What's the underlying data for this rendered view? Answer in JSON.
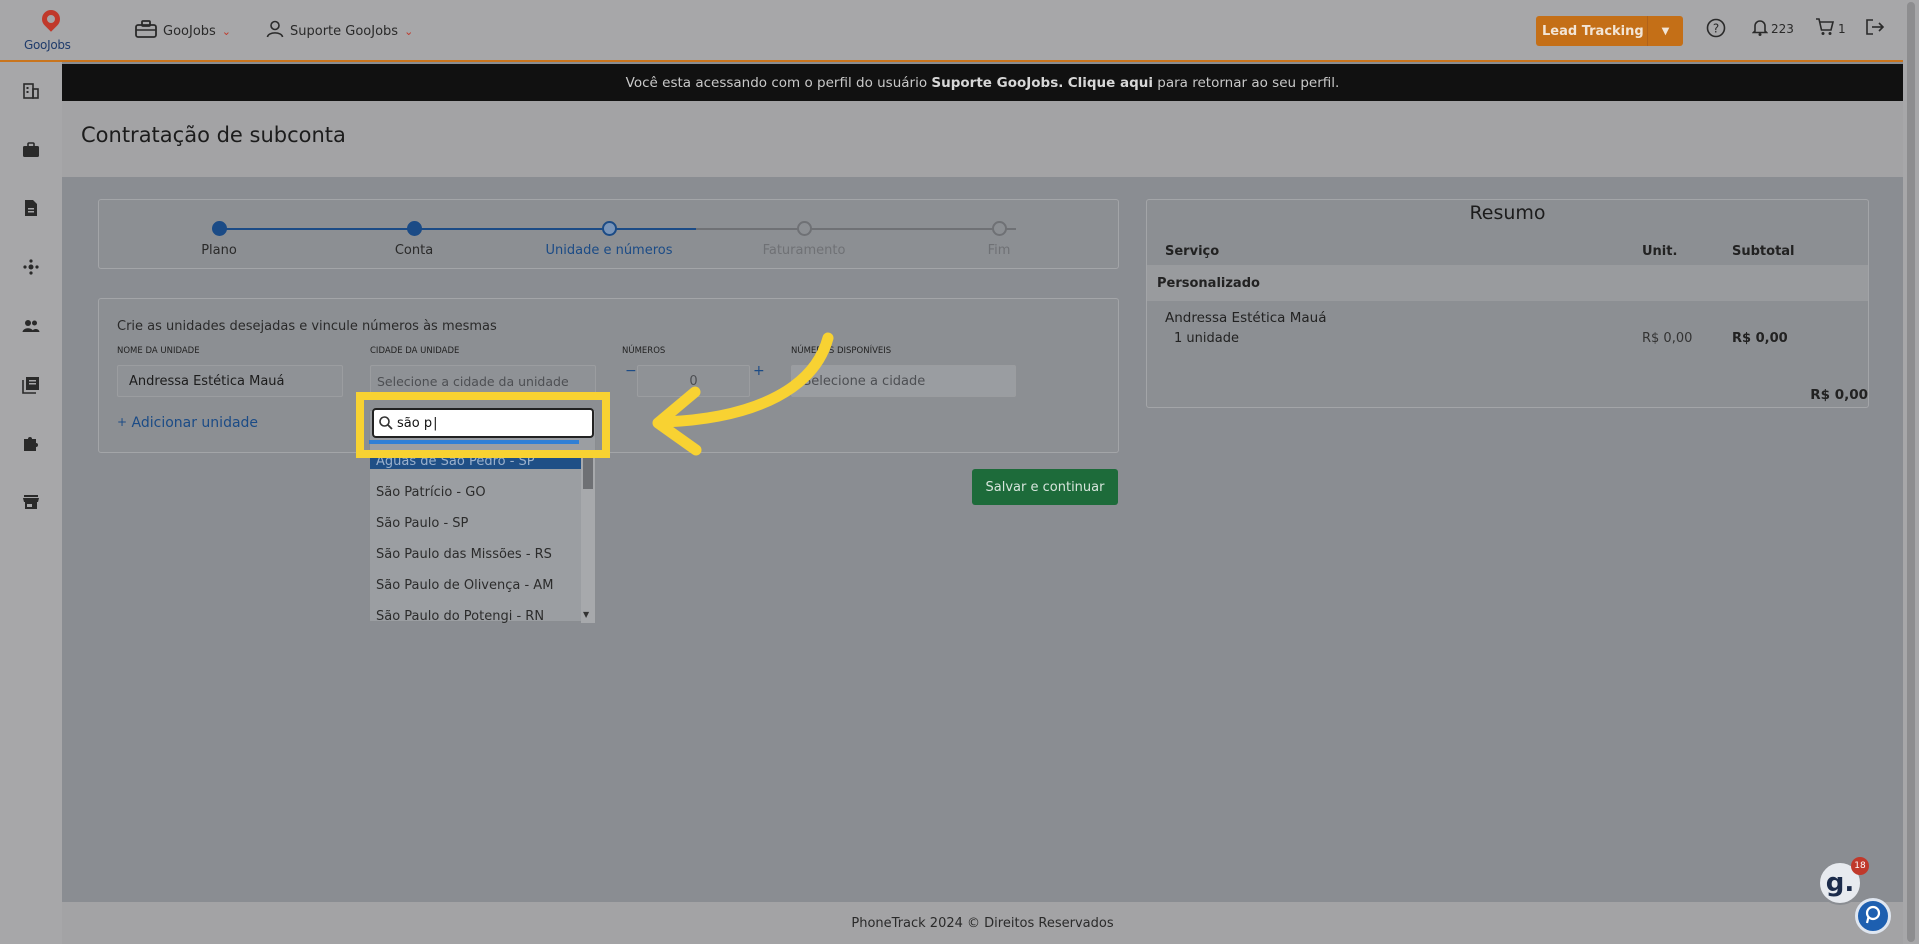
{
  "header": {
    "logo_text": "GooJobs",
    "menu_company": "GooJobs",
    "menu_user": "Suporte GooJobs",
    "lead_button": "Lead Tracking",
    "notifications_count": "223",
    "cart_count": "1"
  },
  "banner": {
    "prefix": "Você esta acessando com o perfil do usuário ",
    "user": "Suporte GooJobs.",
    "link": "Clique aqui",
    "suffix": " para retornar ao seu perfil."
  },
  "page": {
    "title": "Contratação de subconta"
  },
  "stepper": {
    "steps": [
      {
        "label": "Plano",
        "state": "done"
      },
      {
        "label": "Conta",
        "state": "done"
      },
      {
        "label": "Unidade e números",
        "state": "active"
      },
      {
        "label": "Faturamento",
        "state": "pending"
      },
      {
        "label": "Fim",
        "state": "pending"
      }
    ]
  },
  "form": {
    "description": "Crie as unidades desejadas e vincule números às mesmas",
    "unit_name_label": "NOME DA UNIDADE",
    "unit_name_value": "Andressa Estética Mauá",
    "city_label": "CIDADE DA UNIDADE",
    "city_placeholder": "Selecione a cidade da unidade",
    "numbers_label": "NÚMEROS",
    "numbers_value": "0",
    "available_label": "NÚMEROS DISPONÍVEIS",
    "available_placeholder": "Selecione a cidade",
    "add_unit": "Adicionar unidade",
    "minus": "−",
    "plus": "+"
  },
  "dropdown": {
    "search_value": "são p",
    "options": [
      "Águas de São Pedro - SP",
      "São Patrício - GO",
      "São Paulo - SP",
      "São Paulo das Missões - RS",
      "São Paulo de Olivença - AM",
      "São Paulo do Potengi - RN"
    ],
    "highlighted_index": 0
  },
  "actions": {
    "save": "Salvar e continuar"
  },
  "summary": {
    "title": "Resumo",
    "col_service": "Serviço",
    "col_unit": "Unit.",
    "col_subtotal": "Subtotal",
    "group": "Personalizado",
    "item_name": "Andressa Estética Mauá",
    "item_qty": "1 unidade",
    "item_unit": "R$ 0,00",
    "item_subtotal": "R$ 0,00",
    "total": "R$ 0,00"
  },
  "footer": {
    "text": "PhoneTrack 2024 © Direitos Reservados"
  },
  "chat": {
    "badge": "18",
    "letter": "g."
  },
  "colors": {
    "accent_orange": "#c46f17",
    "primary_blue": "#1b4b86",
    "save_green": "#1d6b3a",
    "highlight_yellow": "#f8d232"
  }
}
